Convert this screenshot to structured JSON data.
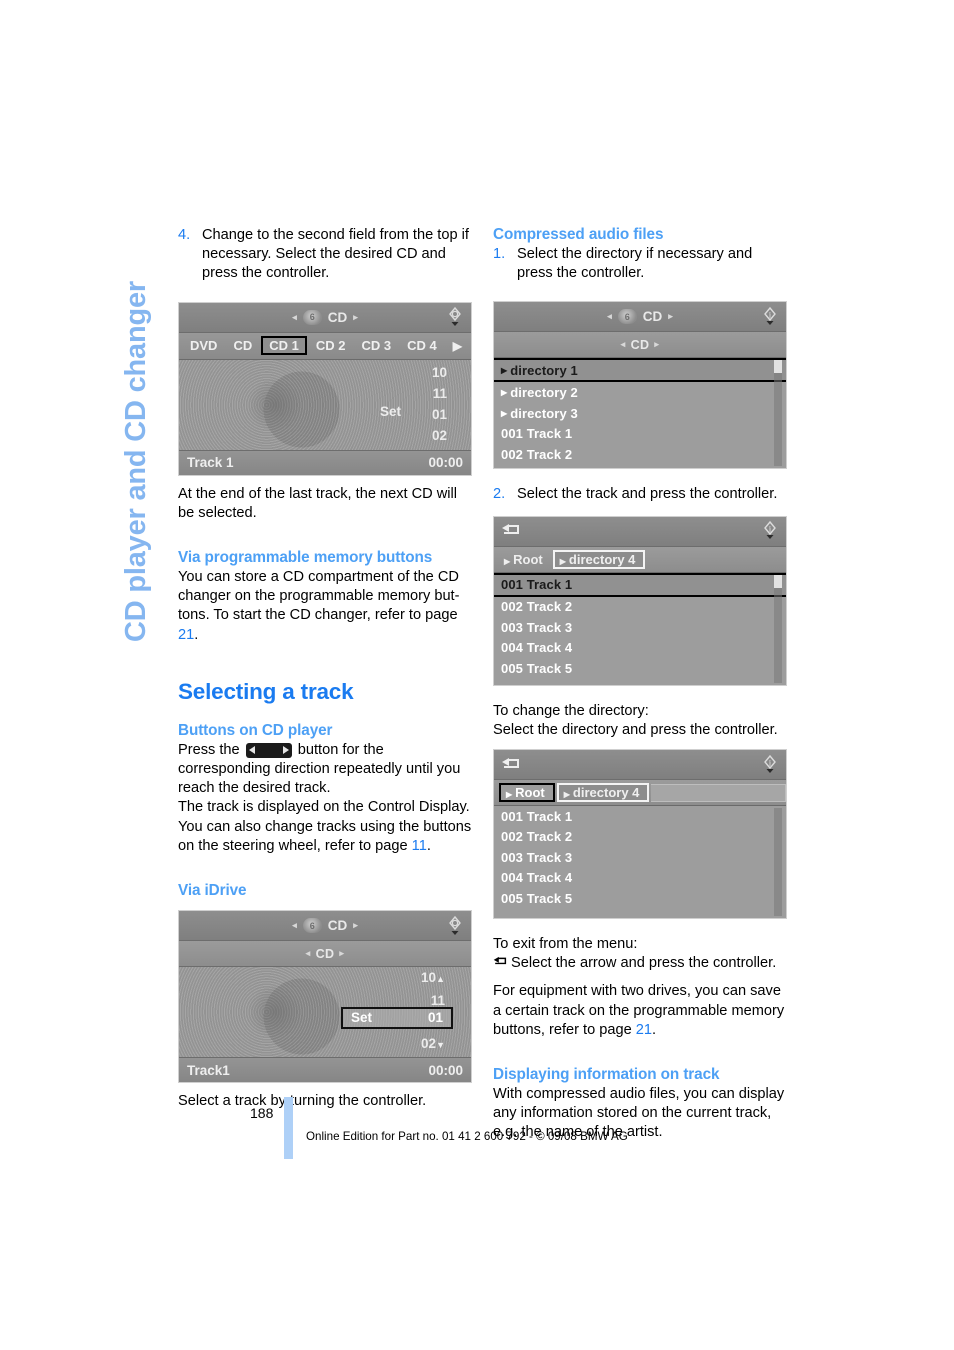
{
  "chapter_title": "CD player and CD changer",
  "left_column": {
    "step4": {
      "num": "4.",
      "text": "Change to the second field from the top if necessary. Select the desired CD and press the controller."
    },
    "screenshot_cd_changer": {
      "name": "cd-changer-display",
      "title_bar": {
        "label": "CD",
        "knob_digit": "6",
        "left_arrow": "◂",
        "right_arrow": "▸",
        "right_icon": "compass-icon"
      },
      "tabs": [
        "DVD",
        "CD",
        "CD 1",
        "CD 2",
        "CD 3",
        "CD 4"
      ],
      "selected_tab": "CD 1",
      "more_arrow": "▶",
      "numbers": [
        "10",
        "11",
        "01",
        "02"
      ],
      "set_label": "Set",
      "track_label": "Track 1",
      "time": "00:00"
    },
    "after_screenshot": "At the end of the last track, the next CD will be selected.",
    "heading_memory": "Via programmable memory buttons",
    "memory_text_1": "You can store a CD compartment of the CD changer on the programmable memory but-tons. To start the CD changer, refer to page ",
    "memory_page_ref": "21",
    "memory_text_2": ".",
    "heading_selecting": "Selecting a track",
    "heading_buttons": "Buttons on CD player",
    "buttons_text_1": "Press the ",
    "buttons_text_2": " button for the corresponding direction repeatedly until you reach the desired track.",
    "buttons_text_3": "The track is displayed on the Control Display. You can also change tracks using the buttons on the steering wheel, refer to page ",
    "buttons_page_ref": "11",
    "buttons_text_4": ".",
    "heading_idrive": "Via iDrive",
    "screenshot_idrive": {
      "name": "idrive-track-select-display",
      "title_bar": {
        "label": "CD",
        "knob_digit": "6",
        "right_icon": "compass-icon"
      },
      "sub_bar": {
        "label": "CD"
      },
      "numbers": [
        "10",
        "11",
        "02"
      ],
      "selected_row": {
        "set_label": "Set",
        "value": "01"
      },
      "track_label": "Track1",
      "time": "00:00"
    },
    "after_idrive": "Select a track by turning the controller."
  },
  "right_column": {
    "heading_compressed": "Compressed audio files",
    "step1": {
      "num": "1.",
      "text": "Select the directory if necessary and press the controller."
    },
    "screenshot_directories": {
      "name": "directory-list-display",
      "title_bar": {
        "label": "CD",
        "knob_digit": "6",
        "right_icon": "info-icon"
      },
      "sub_bar": {
        "label": "CD"
      },
      "rows": [
        "directory 1",
        "directory 2",
        "directory 3",
        "001 Track 1",
        "002 Track 2"
      ],
      "selected_row": "directory 1"
    },
    "step2": {
      "num": "2.",
      "text": "Select the track and press the controller."
    },
    "screenshot_tracks": {
      "name": "track-list-display",
      "title_bar": {
        "back_icon": "back-arrow-icon",
        "right_icon": "info-icon"
      },
      "breadcrumbs": [
        "Root",
        "directory 4"
      ],
      "active_crumb": "directory 4",
      "rows": [
        "001 Track 1",
        "002 Track 2",
        "003 Track 3",
        "004 Track 4",
        "005 Track 5"
      ],
      "selected_row": "001 Track 1"
    },
    "change_dir_1": "To change the directory:",
    "change_dir_2": "Select the directory and press the controller.",
    "screenshot_root": {
      "name": "root-directory-display",
      "title_bar": {
        "back_icon": "back-arrow-icon",
        "right_icon": "info-icon"
      },
      "breadcrumbs": [
        "Root",
        "directory 4"
      ],
      "selected_crumb": "Root",
      "rows": [
        "001 Track 1",
        "002 Track 2",
        "003 Track 3",
        "004 Track 4",
        "005 Track 5"
      ]
    },
    "exit_1": "To exit from the menu:",
    "exit_2": "Select the arrow and press the controller.",
    "two_drives_1": "For equipment with two drives, you can save a certain track on the programmable memory buttons, refer to page ",
    "two_drives_page_ref": "21",
    "two_drives_2": ".",
    "heading_displaying": "Displaying information on track",
    "displaying_text": "With compressed audio files, you can display any information stored on the current track, e.g. the name of the artist."
  },
  "footer": {
    "page_number": "188",
    "note": "Online Edition for Part no. 01 41 2 600 792 - © 09/08 BMW AG"
  },
  "colors": {
    "heading_blue": "#1a7bf0",
    "subhead_blue": "#4da0f5",
    "chapter_blue": "#85b6f0",
    "footer_bar": "#aed0f7"
  }
}
